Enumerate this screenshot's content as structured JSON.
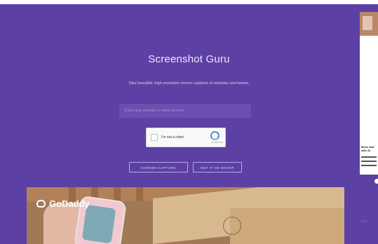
{
  "title": "Screenshot Guru",
  "subtitle": "Take beautiful, high-resolution screen captures of websites and tweets.",
  "url_input": {
    "placeholder": "Enter any website or tweet url here",
    "value": ""
  },
  "captcha": {
    "label": "I'm not a robot",
    "brand": "reCAPTCHA"
  },
  "buttons": {
    "capture": "SCREEN CAPTURE",
    "hd": "GET IT HD SHARP"
  },
  "ad": {
    "brand": "GoDaddy"
  },
  "side_ad": {
    "headline": "Move fast with AI"
  },
  "side_text": "© 2024",
  "colors": {
    "background": "#5d40a4",
    "accent": "#ffffff"
  }
}
